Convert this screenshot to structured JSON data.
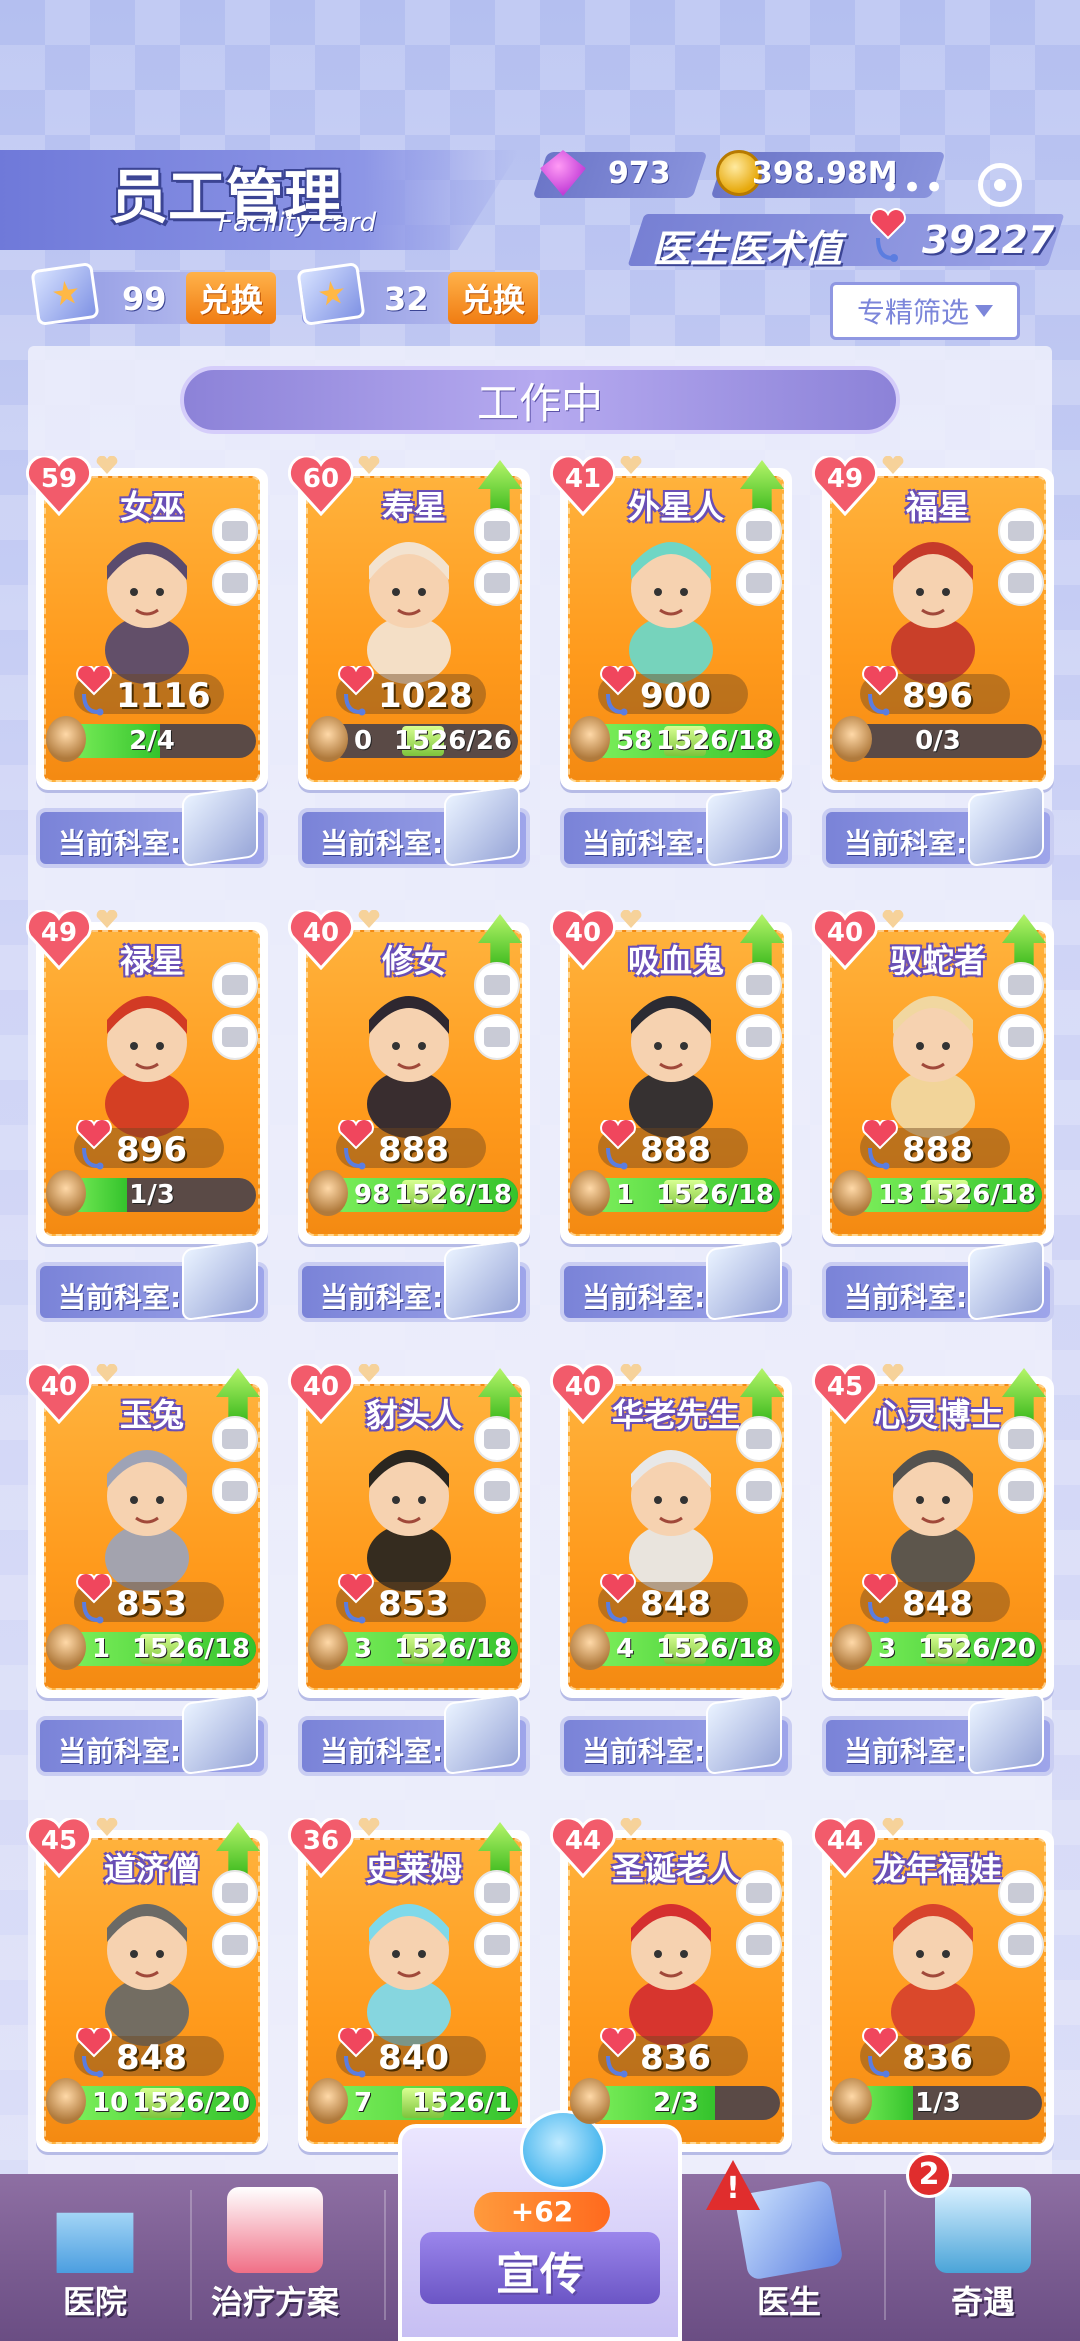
{
  "header": {
    "title": "员工管理",
    "subtitle": "Facility card",
    "gems": "973",
    "coins": "398.98M",
    "more": "•••",
    "doctor_skill_label": "医生医术值",
    "doctor_skill_value": "39227"
  },
  "tickets": [
    {
      "count": "99",
      "button": "兑换"
    },
    {
      "count": "32",
      "button": "兑换"
    }
  ],
  "filter_label": "专精筛选",
  "section_title": "工作中",
  "dept_label": "当前科室:",
  "colors": {
    "card_orange": "#ff9a1c",
    "accent_purple": "#7c86da",
    "progress_green": "#34c32c"
  },
  "cards": [
    {
      "level": "59",
      "name": "女巫",
      "skill": "1116",
      "bar_center": "2/4",
      "upgradable": false,
      "fill": 0.5
    },
    {
      "level": "60",
      "name": "寿星",
      "skill": "1028",
      "bar_left": "0",
      "bar_right": "1526/26",
      "upgradable": true,
      "fill": 0
    },
    {
      "level": "41",
      "name": "外星人",
      "skill": "900",
      "bar_left": "58",
      "bar_right": "1526/18",
      "upgradable": true,
      "fill": 1
    },
    {
      "level": "49",
      "name": "福星",
      "skill": "896",
      "bar_center": "0/3",
      "upgradable": false,
      "fill": 0
    },
    {
      "level": "49",
      "name": "禄星",
      "skill": "896",
      "bar_center": "1/3",
      "upgradable": false,
      "fill": 0.33
    },
    {
      "level": "40",
      "name": "修女",
      "skill": "888",
      "bar_left": "98",
      "bar_right": "1526/18",
      "upgradable": true,
      "fill": 1
    },
    {
      "level": "40",
      "name": "吸血鬼",
      "skill": "888",
      "bar_left": "1",
      "bar_right": "1526/18",
      "upgradable": true,
      "fill": 1
    },
    {
      "level": "40",
      "name": "驭蛇者",
      "skill": "888",
      "bar_left": "13",
      "bar_right": "1526/18",
      "upgradable": true,
      "fill": 1
    },
    {
      "level": "40",
      "name": "玉兔",
      "skill": "853",
      "bar_left": "1",
      "bar_right": "1526/18",
      "upgradable": true,
      "fill": 1
    },
    {
      "level": "40",
      "name": "豺头人",
      "skill": "853",
      "bar_left": "3",
      "bar_right": "1526/18",
      "upgradable": true,
      "fill": 1
    },
    {
      "level": "40",
      "name": "华老先生",
      "skill": "848",
      "bar_left": "4",
      "bar_right": "1526/18",
      "upgradable": true,
      "fill": 1
    },
    {
      "level": "45",
      "name": "心灵博士",
      "skill": "848",
      "bar_left": "3",
      "bar_right": "1526/20",
      "upgradable": true,
      "fill": 1
    },
    {
      "level": "45",
      "name": "道济僧",
      "skill": "848",
      "bar_left": "10",
      "bar_right": "1526/20",
      "upgradable": true,
      "fill": 1
    },
    {
      "level": "36",
      "name": "史莱姆",
      "skill": "840",
      "bar_left": "7",
      "bar_right": "1526/1",
      "upgradable": true,
      "fill": 1
    },
    {
      "level": "44",
      "name": "圣诞老人",
      "skill": "836",
      "bar_center": "2/3",
      "upgradable": false,
      "fill": 0.66
    },
    {
      "level": "44",
      "name": "龙年福娃",
      "skill": "836",
      "bar_center": "1/3",
      "upgradable": false,
      "fill": 0.33
    }
  ],
  "nav": {
    "hospital": "医院",
    "plan": "治疗方案",
    "promo": "宣传",
    "promo_bonus": "+62",
    "doctor": "医生",
    "doctor_alert": "!",
    "event": "奇遇",
    "event_badge": "2"
  }
}
